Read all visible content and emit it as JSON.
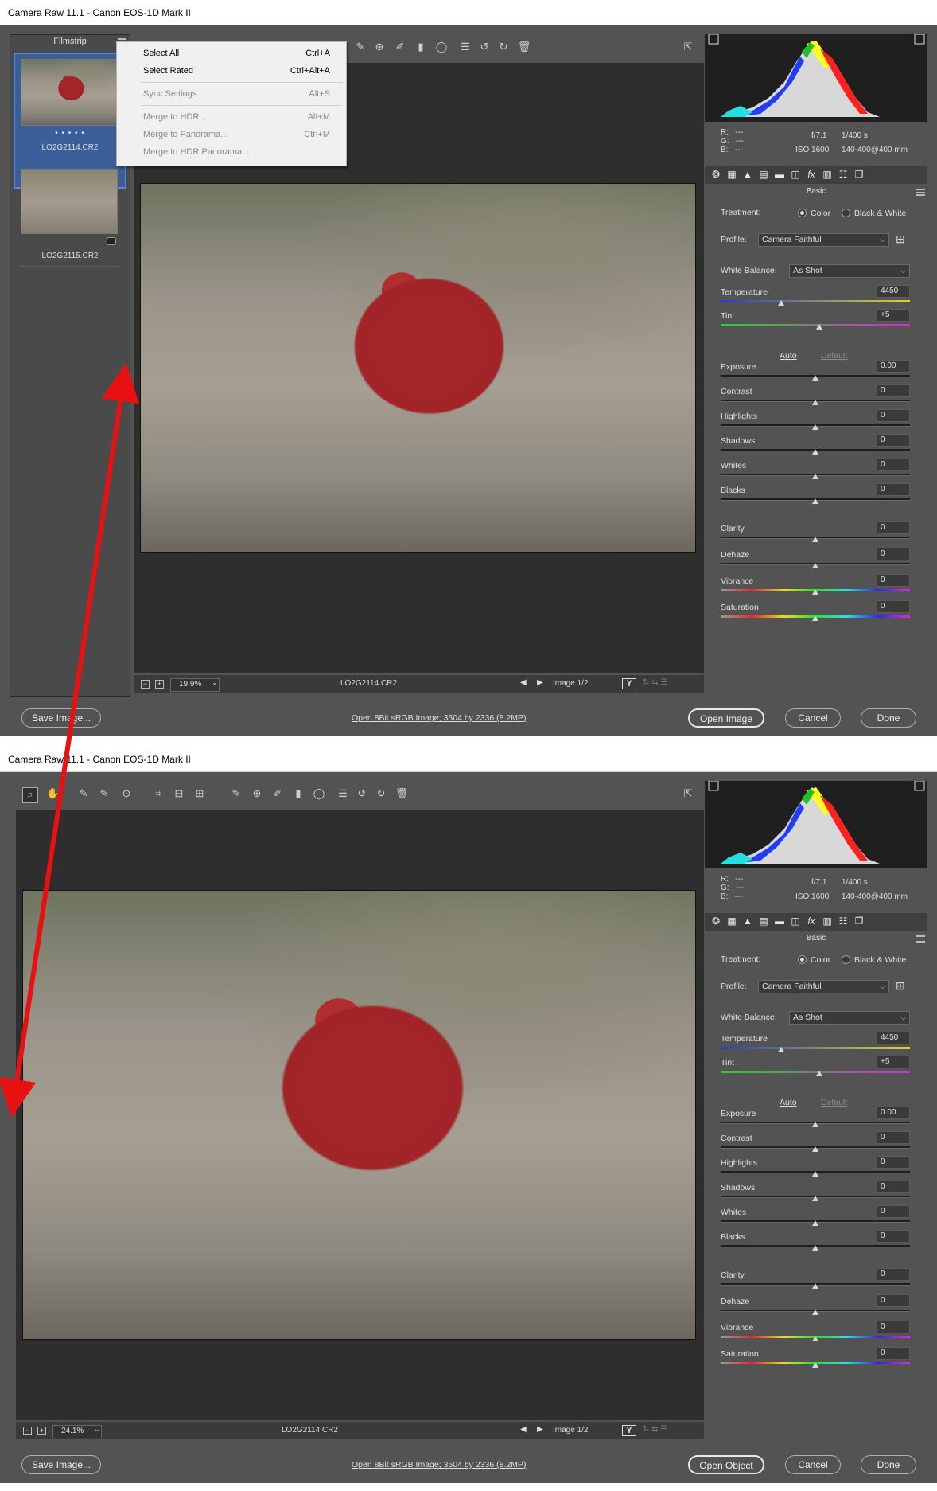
{
  "window1": {
    "title": "Camera Raw 11.1  -  Canon EOS-1D Mark II",
    "filmstrip": {
      "header": "Filmstrip",
      "items": [
        {
          "label": "LO2G2114.CR2",
          "rating": "• • • • •"
        },
        {
          "label": "LO2G2115.CR2"
        }
      ]
    },
    "context_menu": [
      {
        "label": "Select All",
        "shortcut": "Ctrl+A"
      },
      {
        "label": "Select Rated",
        "shortcut": "Ctrl+Alt+A"
      },
      {
        "label": "Sync Settings...",
        "shortcut": "Alt+S"
      },
      {
        "label": "Merge to HDR...",
        "shortcut": "Alt+M"
      },
      {
        "label": "Merge to Panorama...",
        "shortcut": "Ctrl+M"
      },
      {
        "label": "Merge to HDR Panorama...",
        "shortcut": ""
      }
    ],
    "status": {
      "zoom": "19.9%",
      "filename": "LO2G2114.CR2",
      "image_count": "Image 1/2"
    },
    "footer": {
      "save": "Save Image...",
      "info": "Open 8Bit sRGB Image; 3504 by 2336 (8.2MP)",
      "open": "Open Image",
      "cancel": "Cancel",
      "done": "Done"
    }
  },
  "window2": {
    "title": "Camera Raw 11.1  -  Canon EOS-1D Mark II",
    "status": {
      "zoom": "24.1%",
      "filename": "LO2G2114.CR2",
      "image_count": "Image 1/2"
    },
    "footer": {
      "save": "Save Image...",
      "info": "Open 8Bit sRGB Image; 3504 by 2336 (8.2MP)",
      "open": "Open Object",
      "cancel": "Cancel",
      "done": "Done"
    }
  },
  "panel": {
    "rgb": {
      "r": "R:",
      "g": "G:",
      "b": "B:",
      "r_val": "---",
      "g_val": "---",
      "b_val": "---"
    },
    "exif": {
      "aperture": "f/7.1",
      "shutter": "1/400 s",
      "iso": "ISO 1600",
      "lens": "140-400@400 mm"
    },
    "section": "Basic",
    "treatment": {
      "label": "Treatment:",
      "color": "Color",
      "bw": "Black & White",
      "selected": "Color"
    },
    "profile": {
      "label": "Profile:",
      "value": "Camera Faithful"
    },
    "white_balance": {
      "label": "White Balance:",
      "value": "As Shot"
    },
    "auto": "Auto",
    "default": "Default",
    "sliders": [
      {
        "name": "Temperature",
        "value": "4450",
        "pos": 0.32,
        "style": "temp"
      },
      {
        "name": "Tint",
        "value": "+5",
        "pos": 0.52,
        "style": "tint"
      },
      {
        "name": "Exposure",
        "value": "0.00",
        "pos": 0.5,
        "style": "plain"
      },
      {
        "name": "Contrast",
        "value": "0",
        "pos": 0.5,
        "style": "plain"
      },
      {
        "name": "Highlights",
        "value": "0",
        "pos": 0.5,
        "style": "plain"
      },
      {
        "name": "Shadows",
        "value": "0",
        "pos": 0.5,
        "style": "plain"
      },
      {
        "name": "Whites",
        "value": "0",
        "pos": 0.5,
        "style": "plain"
      },
      {
        "name": "Blacks",
        "value": "0",
        "pos": 0.5,
        "style": "plain"
      },
      {
        "name": "Clarity",
        "value": "0",
        "pos": 0.5,
        "style": "plain"
      },
      {
        "name": "Dehaze",
        "value": "0",
        "pos": 0.5,
        "style": "plain"
      },
      {
        "name": "Vibrance",
        "value": "0",
        "pos": 0.5,
        "style": "sat"
      },
      {
        "name": "Saturation",
        "value": "0",
        "pos": 0.5,
        "style": "sat"
      }
    ]
  },
  "annotation_color": "#e81010"
}
